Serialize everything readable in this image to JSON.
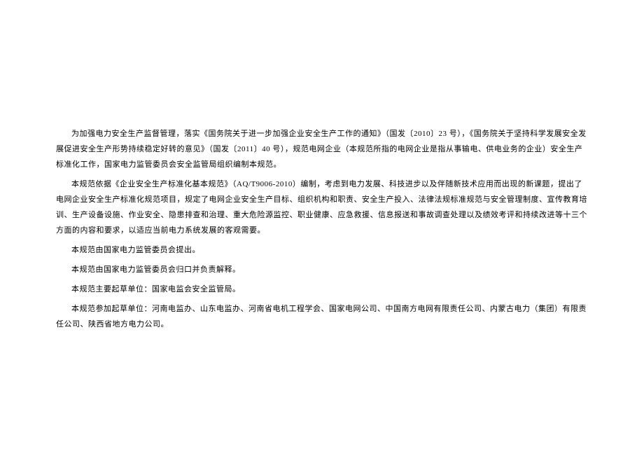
{
  "document": {
    "paragraphs": [
      "为加强电力安全生产监督管理，落实《国务院关于进一步加强企业安全生产工作的通知》（国发〔2010〕23 号），《国务院关于坚持科学发展安全发展促进安全生产形势持续稳定好转的意见》（国发〔2011〕40 号），规范电网企业（本规范所指的电网企业是指从事输电、供电业务的企业）安全生产标准化工作，国家电力监管委员会安全监管局组织编制本规范。",
      "本规范依据《企业安全生产标准化基本规范》（AQ/T9006-2010）编制，考虑到电力发展、科技进步以及伴随新技术应用而出现的新课题，提出了电网企业安全生产标准化规范项目，规定了电网企业安全生产目标、组织机构和职责、安全生产投入、法律法规标准规范与安全管理制度、宣传教育培训、生产设备设施、作业安全、隐患排查和治理、重大危险源监控、职业健康、应急救援、信息报送和事故调查处理以及绩效考评和持续改进等十三个方面的内容和要求，以适应当前电力系统发展的客观需要。",
      "本规范由国家电力监管委员会提出。",
      "本规范由国家电力监管委员会归口并负责解释。",
      "本规范主要起草单位：国家电监会安全监管局。",
      "本规范参加起草单位：河南电监办、山东电监办、河南省电机工程学会、国家电网公司、中国南方电网有限责任公司、内蒙古电力（集团）有限责任公司、陕西省地方电力公司。"
    ]
  }
}
